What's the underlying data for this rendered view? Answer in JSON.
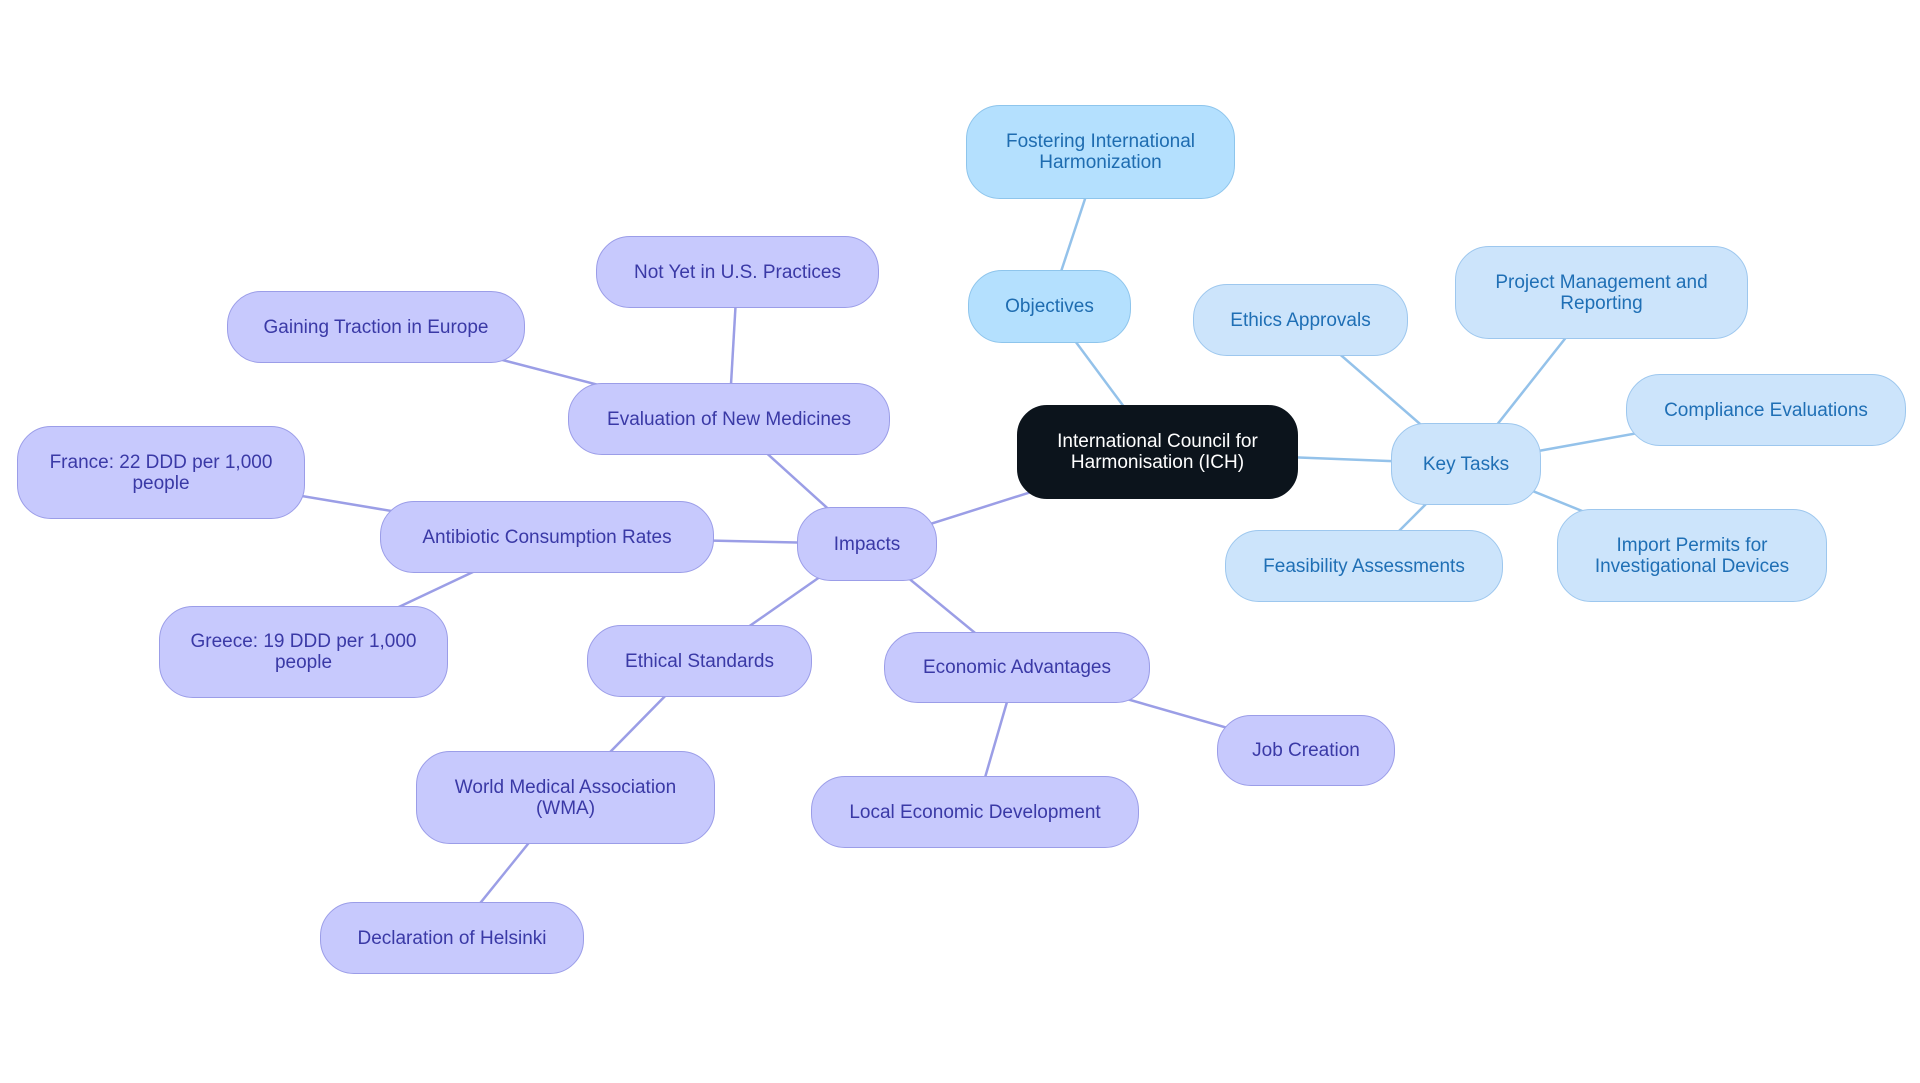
{
  "title": "International Council for Harmonisation (ICH) mind map",
  "colors": {
    "root_fill": "#0c141c",
    "purple_fill": "#c7c9fd",
    "purple_text": "#3a39a6",
    "purple_line": "#9b9ee6",
    "blue_fill": "#cce4fb",
    "blue_text": "#1f6fb5",
    "blue_line": "#94c2ea",
    "sky_fill": "#b4e0fe"
  },
  "nodes": [
    {
      "id": "ich",
      "label": "International Council for\nHarmonisation (ICH)",
      "style": "root",
      "parent": null
    },
    {
      "id": "objectives",
      "label": "Objectives",
      "style": "sky",
      "parent": "ich"
    },
    {
      "id": "fostering",
      "label": "Fostering International\nHarmonization",
      "style": "sky",
      "parent": "objectives"
    },
    {
      "id": "key-tasks",
      "label": "Key Tasks",
      "style": "blue",
      "parent": "ich"
    },
    {
      "id": "ethics-approvals",
      "label": "Ethics Approvals",
      "style": "blue",
      "parent": "key-tasks"
    },
    {
      "id": "project-management",
      "label": "Project Management and\nReporting",
      "style": "blue",
      "parent": "key-tasks"
    },
    {
      "id": "compliance",
      "label": "Compliance Evaluations",
      "style": "blue",
      "parent": "key-tasks"
    },
    {
      "id": "import-permits",
      "label": "Import Permits for\nInvestigational Devices",
      "style": "blue",
      "parent": "key-tasks"
    },
    {
      "id": "feasibility",
      "label": "Feasibility Assessments",
      "style": "blue",
      "parent": "key-tasks"
    },
    {
      "id": "impacts",
      "label": "Impacts",
      "style": "purple",
      "parent": "ich"
    },
    {
      "id": "evaluation",
      "label": "Evaluation of New Medicines",
      "style": "purple",
      "parent": "impacts"
    },
    {
      "id": "not-yet-us",
      "label": "Not Yet in U.S. Practices",
      "style": "purple",
      "parent": "evaluation"
    },
    {
      "id": "gaining-europe",
      "label": "Gaining Traction in Europe",
      "style": "purple",
      "parent": "evaluation"
    },
    {
      "id": "antibiotic",
      "label": "Antibiotic Consumption Rates",
      "style": "purple",
      "parent": "impacts"
    },
    {
      "id": "france",
      "label": "France: 22 DDD per 1,000\npeople",
      "style": "purple",
      "parent": "antibiotic"
    },
    {
      "id": "greece",
      "label": "Greece: 19 DDD per 1,000\npeople",
      "style": "purple",
      "parent": "antibiotic"
    },
    {
      "id": "ethical-standards",
      "label": "Ethical Standards",
      "style": "purple",
      "parent": "impacts"
    },
    {
      "id": "wma",
      "label": "World Medical Association\n(WMA)",
      "style": "purple",
      "parent": "ethical-standards"
    },
    {
      "id": "helsinki",
      "label": "Declaration of Helsinki",
      "style": "purple",
      "parent": "wma"
    },
    {
      "id": "economic",
      "label": "Economic Advantages",
      "style": "purple",
      "parent": "impacts"
    },
    {
      "id": "job-creation",
      "label": "Job Creation",
      "style": "purple",
      "parent": "economic"
    },
    {
      "id": "local-economic",
      "label": "Local Economic Development",
      "style": "purple",
      "parent": "economic"
    }
  ]
}
